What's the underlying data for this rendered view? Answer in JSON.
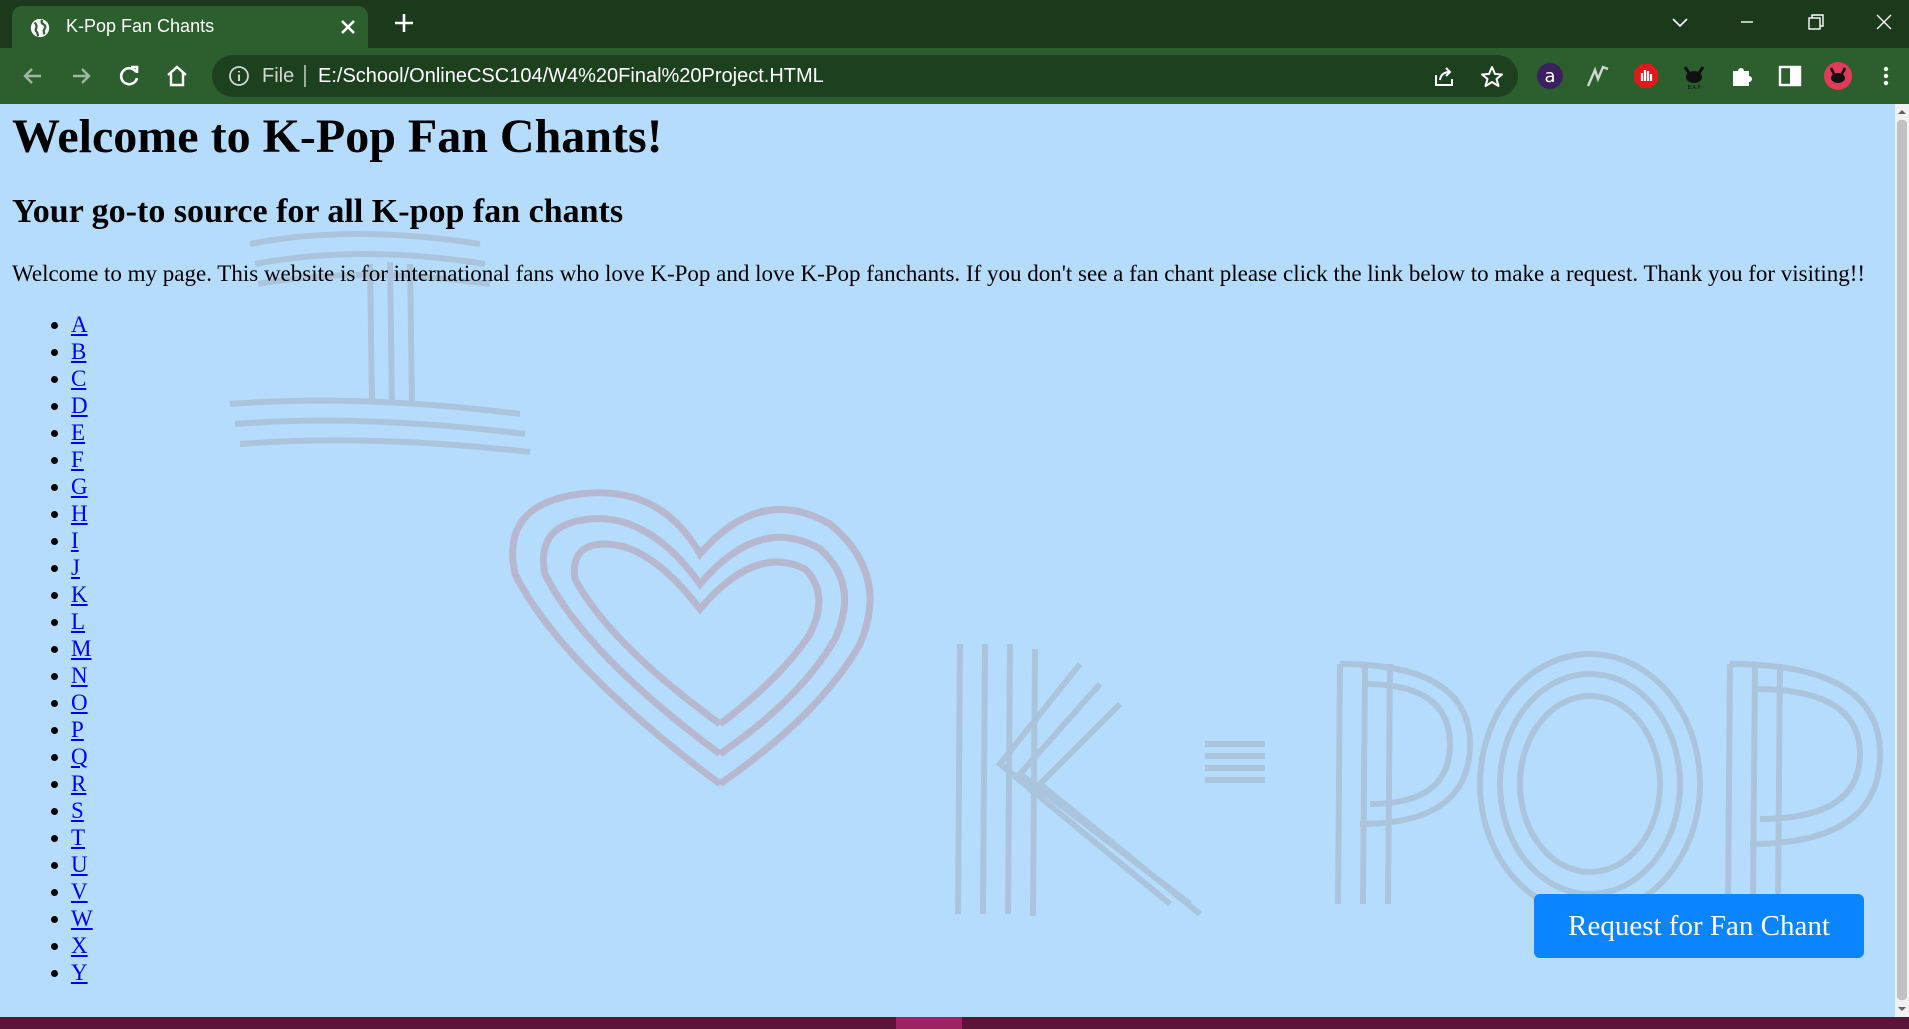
{
  "browser": {
    "tab_title": "K-Pop Fan Chants",
    "url_scheme": "File",
    "url": "E:/School/OnlineCSC104/W4%20Final%20Project.HTML"
  },
  "page": {
    "heading": "Welcome to K-Pop Fan Chants!",
    "subheading": "Your go-to source for all K-pop fan chants",
    "intro": "Welcome to my page. This website is for international fans who love K-Pop and love K-Pop fanchants. If you don't see a fan chant please click the link below to make a request. Thank you for visiting!!",
    "letters": [
      "A",
      "B",
      "C",
      "D",
      "E",
      "F",
      "G",
      "H",
      "I",
      "J",
      "K",
      "L",
      "M",
      "N",
      "O",
      "P",
      "Q",
      "R",
      "S",
      "T",
      "U",
      "V",
      "W",
      "X",
      "Y"
    ],
    "request_button": "Request for Fan Chant",
    "background_text": "I ♥ K-POP"
  },
  "colors": {
    "chrome": "#2c5e2e",
    "page_bg": "#b6dcfd",
    "button": "#0a84ff",
    "link": "#0000ee"
  }
}
